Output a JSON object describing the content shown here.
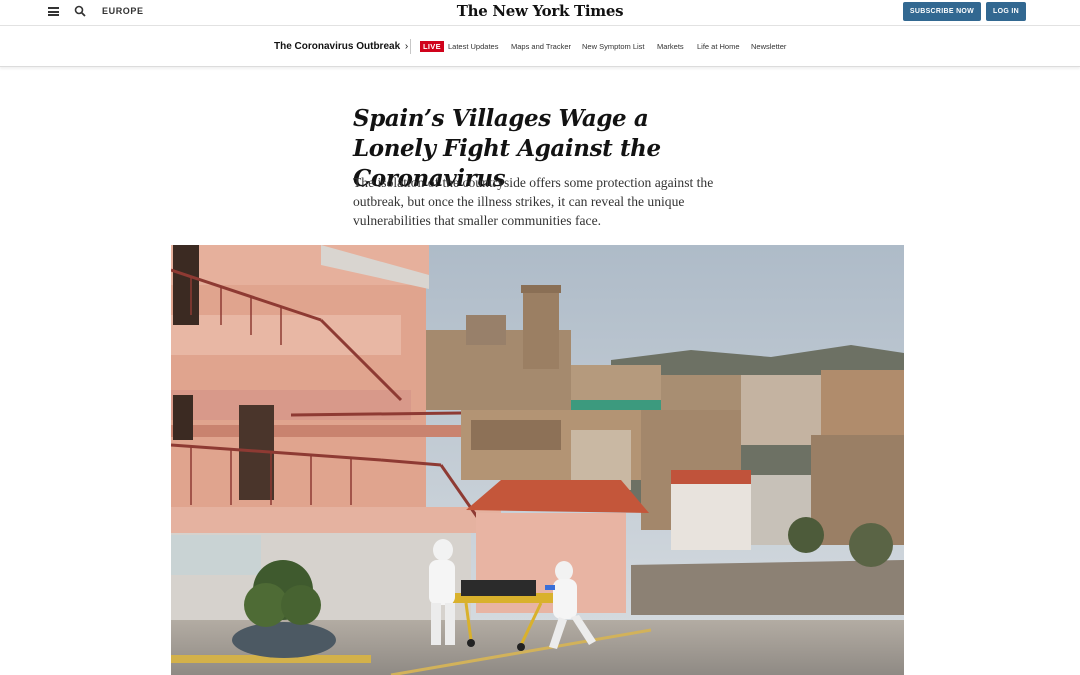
{
  "masthead": {
    "edition_label": "EUROPE",
    "logo_text": "The New York Times",
    "subscribe_label": "SUBSCRIBE NOW",
    "login_label": "LOG IN"
  },
  "subnav": {
    "section_title": "The Coronavirus Outbreak",
    "section_chevron": "›",
    "live_label": "LIVE",
    "links": [
      "Latest Updates",
      "Maps and Tracker",
      "New Symptom List",
      "Markets",
      "Life at Home",
      "Newsletter"
    ]
  },
  "article": {
    "headline": "Spain’s Villages Wage a Lonely Fight Against the Coronavirus",
    "summary": "The isolation of the countryside offers some protection against the outbreak, but once the illness strikes, it can reveal the unique vulnerabilities that smaller communities face."
  },
  "colors": {
    "button_blue": "#326891",
    "live_red": "#d0021b",
    "headline_text": "#121212"
  },
  "icons": [
    "menu-icon",
    "search-icon"
  ]
}
